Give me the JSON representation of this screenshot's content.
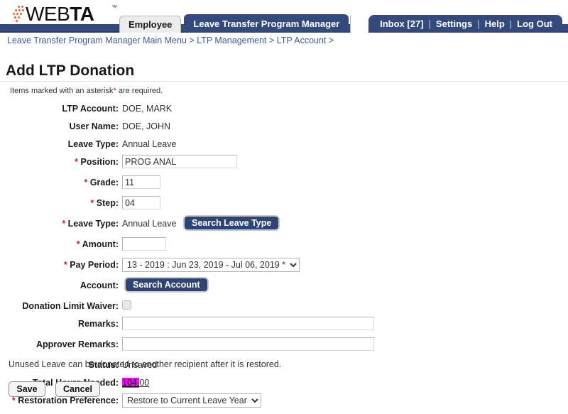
{
  "header": {
    "logo": {
      "text_light": "WEB",
      "text_bold": "TA",
      "trademark": "™",
      "dot_color": "#e8622a"
    },
    "tabs": [
      {
        "label": "Employee",
        "active": false
      },
      {
        "label": "Leave Transfer Program Manager",
        "active": true
      }
    ],
    "utility": {
      "inbox": "Inbox [27]",
      "settings": "Settings",
      "help": "Help",
      "logout": "Log Out",
      "separator": "|"
    },
    "bar_color": "#34497c"
  },
  "breadcrumb": {
    "items": [
      "Leave Transfer Program Manager Main Menu",
      "LTP Management",
      "LTP Account"
    ],
    "separator": ">",
    "trailing": ">",
    "link_color": "#3d5a99",
    "full_text": "Leave Transfer Program Manager Main Menu > LTP Management > LTP Account >"
  },
  "page": {
    "title": "Add LTP Donation",
    "required_hint_prefix": "Items marked with an asterisk",
    "required_hint_asterisk": "*",
    "required_hint_suffix": " are required."
  },
  "form": {
    "ltp_account": {
      "label": "LTP Account:",
      "value": "DOE, MARK"
    },
    "user_name": {
      "label": "User Name:",
      "value": "DOE, JOHN"
    },
    "leave_type_display": {
      "label": "Leave Type:",
      "value": "Annual Leave"
    },
    "position": {
      "label": "Position:",
      "required": true,
      "value": "PROG ANAL"
    },
    "grade": {
      "label": "Grade:",
      "required": true,
      "value": "11"
    },
    "step": {
      "label": "Step:",
      "required": true,
      "value": "04"
    },
    "leave_type": {
      "label": "Leave Type:",
      "required": true,
      "value": "Annual Leave",
      "button": "Search Leave Type"
    },
    "amount": {
      "label": "Amount:",
      "required": true,
      "value": "",
      "placeholder": ""
    },
    "pay_period": {
      "label": "Pay Period:",
      "required": true,
      "selected": "13 - 2019 : Jun 23, 2019 - Jul 06, 2019 *",
      "options": [
        "13 - 2019 : Jun 23, 2019 - Jul 06, 2019 *"
      ]
    },
    "account": {
      "label": "Account:",
      "button": "Search Account"
    },
    "donation_limit_waiver": {
      "label": "Donation Limit Waiver:",
      "checked": false
    },
    "remarks": {
      "label": "Remarks:",
      "value": "",
      "placeholder": ""
    },
    "approver_remarks": {
      "label": "Approver Remarks:",
      "value": "",
      "placeholder": ""
    },
    "status": {
      "label": "Status:",
      "value": "Unsaved"
    },
    "total_hours_needed": {
      "label": "Total Hours Needed:",
      "value": "104.00",
      "highlighted_part": "104.",
      "remainder_part": "00",
      "highlight_color": "#ff00ff"
    },
    "restoration_preference": {
      "label": "Restoration Preference:",
      "required": true,
      "selected": "Restore to Current Leave Year",
      "options": [
        "Restore to Current Leave Year"
      ]
    },
    "required_marker": "*"
  },
  "footer": {
    "note": "Unused Leave can be donated to another recipient after it is restored.",
    "save_label": "Save",
    "cancel_label": "Cancel"
  }
}
